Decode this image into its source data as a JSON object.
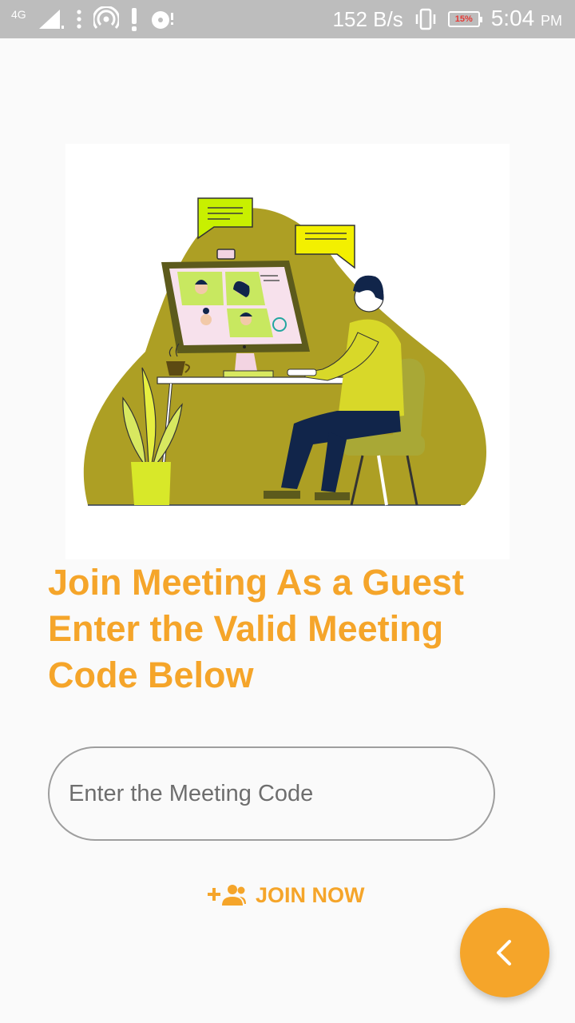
{
  "status_bar": {
    "network_label": "4G",
    "speed": "152 B/s",
    "battery": "15%",
    "time": "5:04",
    "ampm": "PM",
    "icons": [
      "signal-icon",
      "more-icon",
      "hotspot-icon",
      "alert-icon",
      "disc-icon",
      "vibrate-icon",
      "battery-icon"
    ]
  },
  "main": {
    "heading": "Join Meeting As a Guest Enter the Valid Meeting Code Below",
    "input": {
      "placeholder": "Enter the Meeting Code",
      "value": ""
    },
    "join_button": {
      "label": "JOIN NOW",
      "icon": "add-group-icon"
    },
    "fab": {
      "icon": "chevron-left-icon"
    }
  },
  "colors": {
    "accent": "#f5a52a",
    "status_bar": "#bdbdbd",
    "background": "#fafafa",
    "illustration_blob": "#ad9f24",
    "illustration_shirt": "#d8d829",
    "illustration_pants": "#11254a"
  }
}
